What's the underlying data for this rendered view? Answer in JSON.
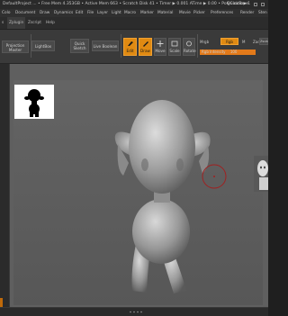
{
  "titlebar": {
    "text": "DefaultProject ... • Free Mem 4.353GB • Active Mem 663 • Scratch Disk 41 • Timer ▶ 0.001 ATime ▶ 0.00 • PolyCount ▶ 1",
    "quicksave": "QuickSave"
  },
  "menubar": {
    "items": [
      "Colo",
      "Document",
      "Draw",
      "Dynamics",
      "Edit",
      "File",
      "Layer",
      "Light",
      "Macro",
      "Marker",
      "Material",
      "Movie",
      "Picker",
      "Preferences",
      "Render",
      "Sten"
    ]
  },
  "subbar": {
    "items": [
      "s",
      "Zplugin",
      "Zscript",
      "Help"
    ]
  },
  "toolbar": {
    "projection_master": "Projection Master",
    "lightbox": "LightBox",
    "quick_sketch": "Quick Sketch",
    "live_boolean": "Live Boolean",
    "edit": "Edit",
    "draw": "Draw",
    "move": "Move",
    "scale": "Scale",
    "rotate": "Rotate",
    "mrgb": "Mrgb",
    "rgb": "Rgb",
    "m": "M",
    "zadd": "Zadd",
    "zsub": "Zsub",
    "rgb_intensity_label": "Rgb Intensity",
    "rgb_intensity_value": "100",
    "rgb_intensity_fraction": 1.0
  },
  "colors": {
    "accent": "#e08a12",
    "canvas_bg": "#5f5f5f",
    "circle_marker": "#a02020"
  },
  "icons": [
    "projection-master-icon",
    "edit-brush-icon",
    "draw-icon",
    "move-icon",
    "scale-icon",
    "rotate-icon",
    "resize-handle-icon"
  ]
}
